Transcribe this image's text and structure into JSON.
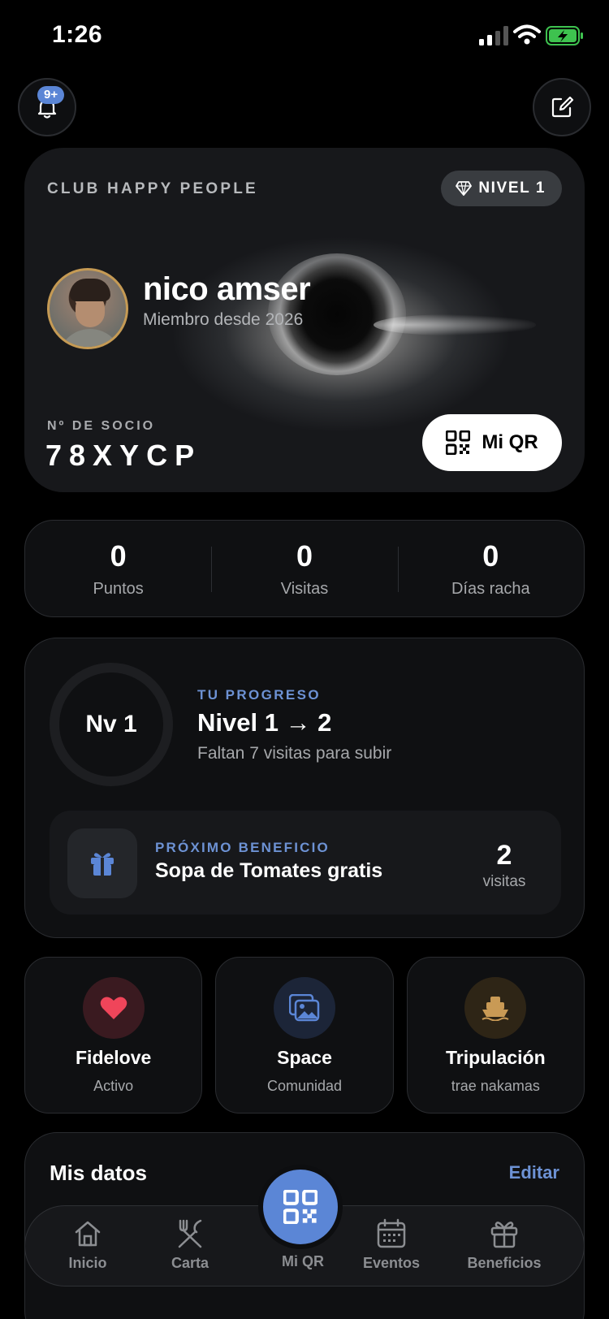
{
  "status_bar": {
    "time": "1:26"
  },
  "header": {
    "notification_badge": "9+"
  },
  "member_card": {
    "club_name": "CLUB HAPPY PEOPLE",
    "level_label": "NIVEL 1",
    "name": "nico amser",
    "member_since": "Miembro desde 2026",
    "socio_label": "Nº DE SOCIO",
    "socio_id": "78XYCP",
    "qr_button_label": "Mi QR"
  },
  "stats": [
    {
      "value": "0",
      "label": "Puntos"
    },
    {
      "value": "0",
      "label": "Visitas"
    },
    {
      "value": "0",
      "label": "Días racha"
    }
  ],
  "progress": {
    "ring_label": "Nv 1",
    "progress_fraction": 0,
    "eyebrow": "TU PROGRESO",
    "title": "Nivel 1 → 2",
    "subtitle": "Faltan 7 visitas para subir",
    "next_benefit": {
      "eyebrow": "PRÓXIMO BENEFICIO",
      "title": "Sopa de Tomates gratis",
      "count": "2",
      "unit": "visitas",
      "icon": "gift-icon"
    }
  },
  "tiles": [
    {
      "title": "Fidelove",
      "subtitle": "Activo",
      "icon": "heart-icon",
      "color": "#f0455a"
    },
    {
      "title": "Space",
      "subtitle": "Comunidad",
      "icon": "image-icon",
      "color": "#5b86d6"
    },
    {
      "title": "Tripulación",
      "subtitle": "trae nakamas",
      "icon": "ship-icon",
      "color": "#c99a55"
    }
  ],
  "mis_datos": {
    "title": "Mis datos",
    "edit_label": "Editar"
  },
  "tabbar": {
    "items": [
      {
        "label": "Inicio",
        "icon": "home-icon"
      },
      {
        "label": "Carta",
        "icon": "utensils-icon"
      },
      {
        "label": "Mi QR",
        "icon": "qr-icon"
      },
      {
        "label": "Eventos",
        "icon": "calendar-icon"
      },
      {
        "label": "Beneficios",
        "icon": "gift-icon"
      }
    ]
  },
  "colors": {
    "accent": "#5b86d6",
    "gold": "#c59a54",
    "background": "#000000"
  }
}
